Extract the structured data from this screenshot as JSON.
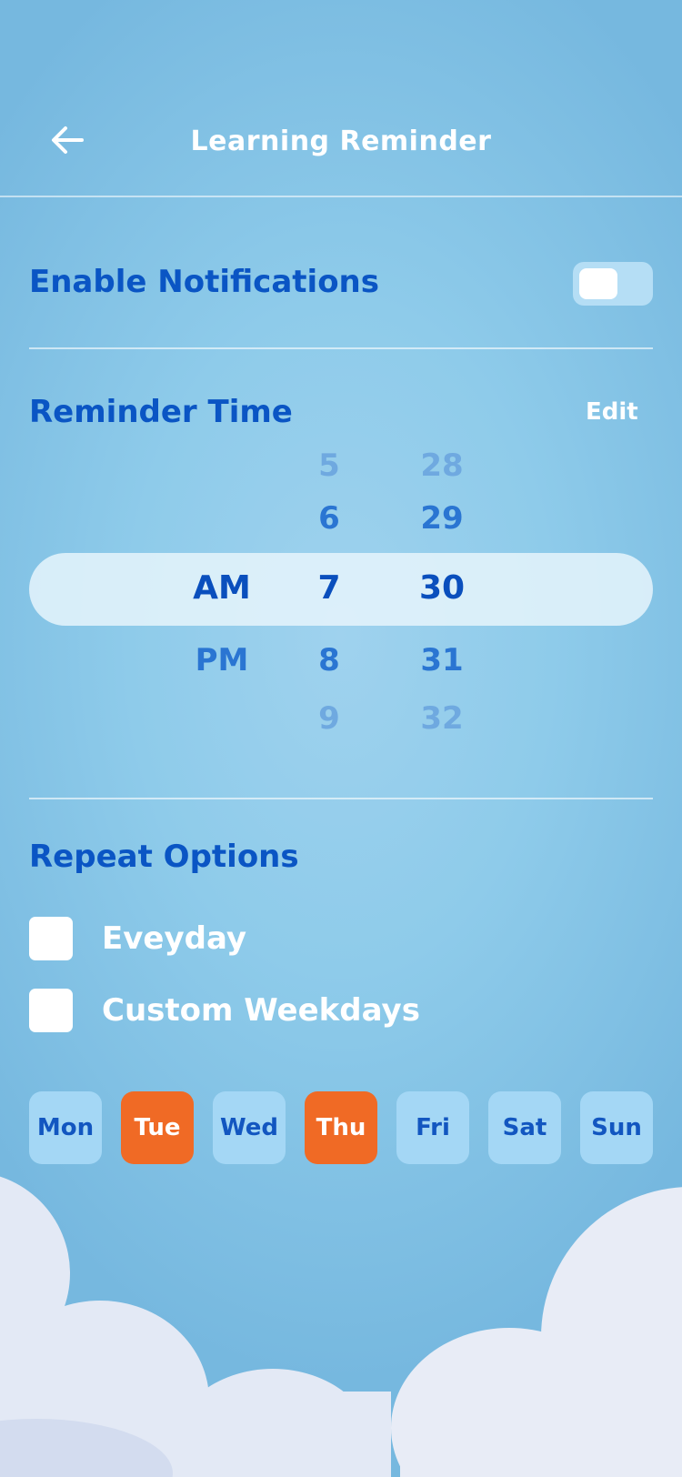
{
  "header": {
    "title": "Learning Reminder",
    "back_icon": "arrow-left-icon"
  },
  "notifications": {
    "label": "Enable Notifications",
    "enabled": false
  },
  "reminder": {
    "label": "Reminder Time",
    "edit_label": "Edit",
    "period": {
      "selected": "AM",
      "next": "PM"
    },
    "hours": [
      "5",
      "6",
      "7",
      "8",
      "9"
    ],
    "minutes": [
      "28",
      "29",
      "30",
      "31",
      "32"
    ]
  },
  "repeat": {
    "label": "Repeat Options",
    "options": [
      {
        "label": "Eveyday",
        "checked": false
      },
      {
        "label": "Custom Weekdays",
        "checked": false
      }
    ],
    "days": [
      {
        "label": "Mon",
        "selected": false
      },
      {
        "label": "Tue",
        "selected": true
      },
      {
        "label": "Wed",
        "selected": false
      },
      {
        "label": "Thu",
        "selected": true
      },
      {
        "label": "Fri",
        "selected": false
      },
      {
        "label": "Sat",
        "selected": false
      },
      {
        "label": "Sun",
        "selected": false
      }
    ]
  },
  "colors": {
    "accent": "#f06a25",
    "primary_text": "#0a55c4",
    "background": "#8ecbea"
  }
}
